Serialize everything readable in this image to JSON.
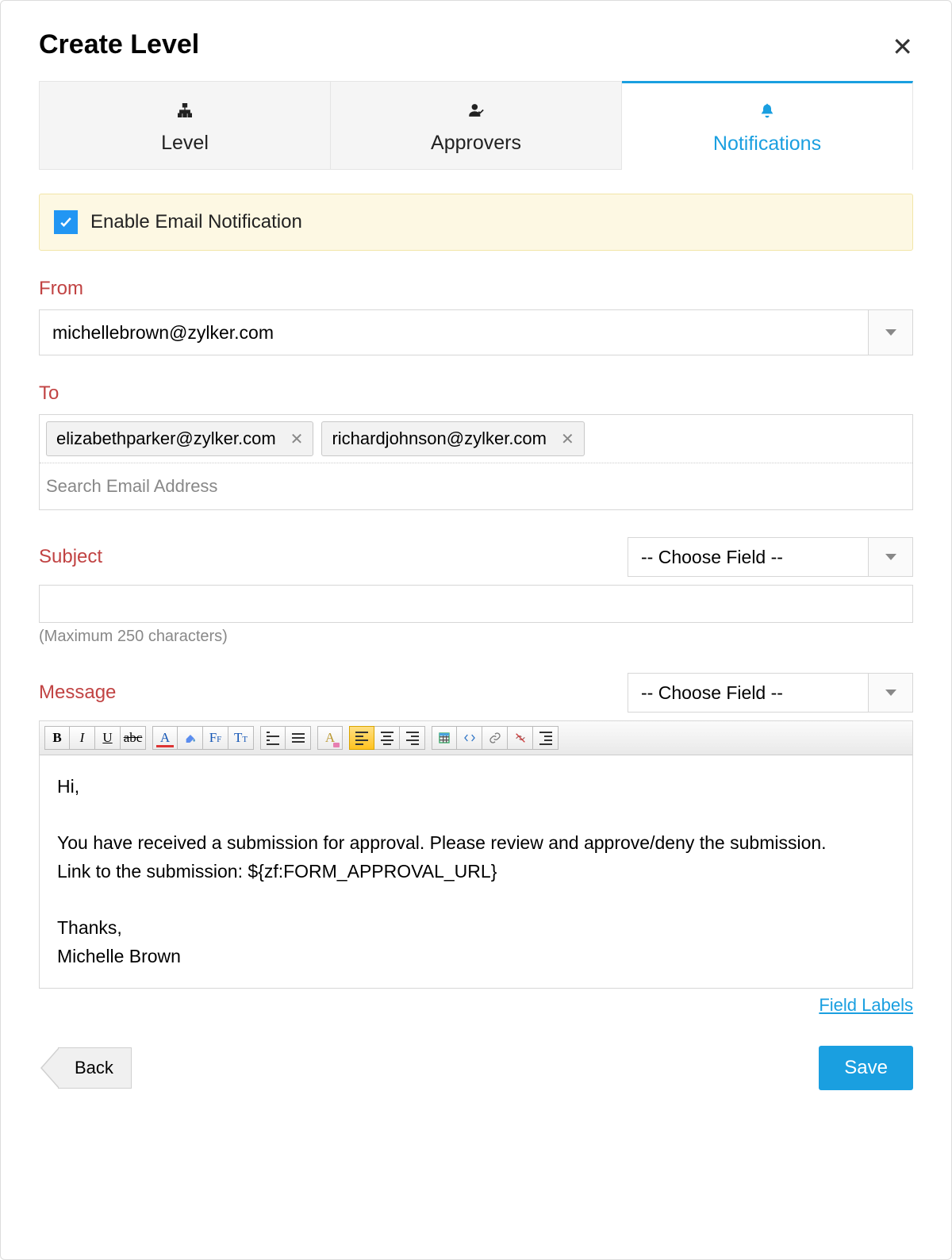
{
  "title": "Create Level",
  "tabs": {
    "level": "Level",
    "approvers": "Approvers",
    "notifications": "Notifications",
    "active": "notifications"
  },
  "enable": {
    "checked": true,
    "label": "Enable Email Notification"
  },
  "from": {
    "label": "From",
    "value": "michellebrown@zylker.com"
  },
  "to": {
    "label": "To",
    "chips": [
      "elizabethparker@zylker.com",
      "richardjohnson@zylker.com"
    ],
    "placeholder": "Search Email Address"
  },
  "subject": {
    "label": "Subject",
    "choose_placeholder": "-- Choose Field --",
    "value": "",
    "hint": "(Maximum 250 characters)"
  },
  "message": {
    "label": "Message",
    "choose_placeholder": "-- Choose Field --",
    "body": "Hi,\n\nYou have received a submission for approval. Please review and approve/deny the submission.\nLink to the submission: ${zf:FORM_APPROVAL_URL}\n\nThanks,\nMichelle Brown"
  },
  "field_labels_link": "Field Labels",
  "footer": {
    "back": "Back",
    "save": "Save"
  }
}
